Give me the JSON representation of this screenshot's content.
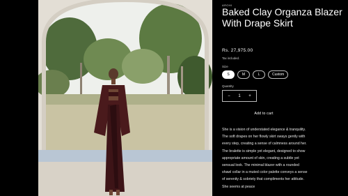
{
  "product": {
    "vendor": "AROHI",
    "title": "Baked Clay Organza Blazer With Drape Skirt",
    "price": "Rs. 27,975.00",
    "tax_note": "Tax included.",
    "size_label": "Size",
    "sizes": [
      "S",
      "M",
      "L",
      "Custom"
    ],
    "selected_size": "S",
    "quantity_label": "Quantity",
    "quantity_value": "1",
    "decrease_symbol": "−",
    "increase_symbol": "+",
    "add_to_cart_label": "Add to cart",
    "description": "She is a vision of understated elegance & tranquility. The soft drapes on her flowly skirt sways gently with every step, creating a sense of calmness around her. The bralette is simple yet elegant, designed to show appropriate amount of skin, creating a subtle yet sensual look. The minimal blazer with a rounded shawl collar in a muted color palette conveys a sense of serenity & sobriety that compliments her attitude. She seems at peace"
  },
  "image": {
    "alt_icon": "product-photo"
  },
  "colors": {
    "background": "#000000",
    "accent_outfit": "#4a1a1c"
  }
}
